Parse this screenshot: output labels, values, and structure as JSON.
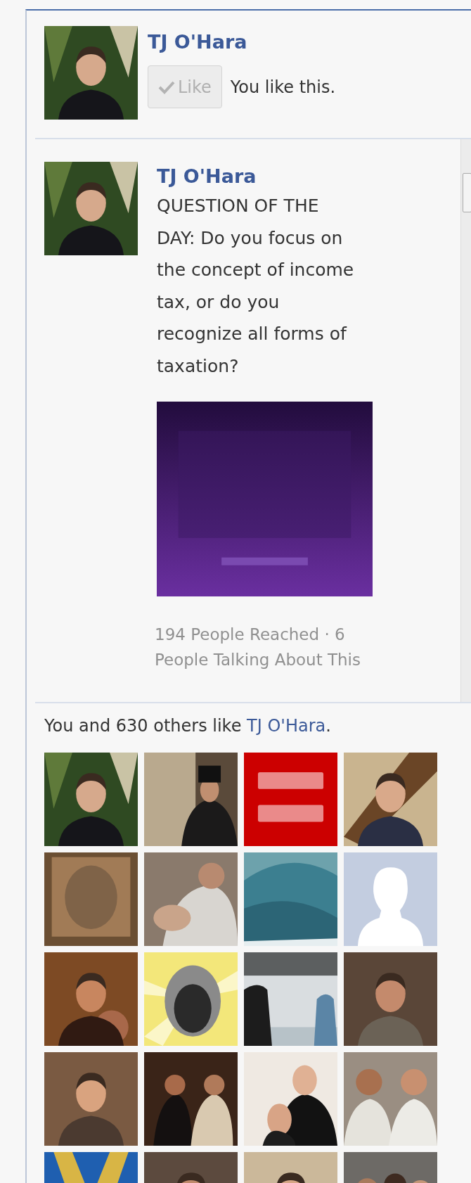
{
  "page": {
    "name": "TJ O'Hara",
    "like_button": {
      "label": "Like",
      "liked": true
    },
    "like_status": "You like this."
  },
  "post": {
    "author": "TJ O'Hara",
    "text": "QUESTION OF THE DAY: Do you focus on the concept of income tax, or do you recognize all forms of taxation?",
    "stats": "194 People Reached · 6 People Talking About This"
  },
  "likes": {
    "summary_prefix": "You and 630 others like ",
    "page_link": "TJ O'Hara",
    "summary_suffix": "."
  }
}
